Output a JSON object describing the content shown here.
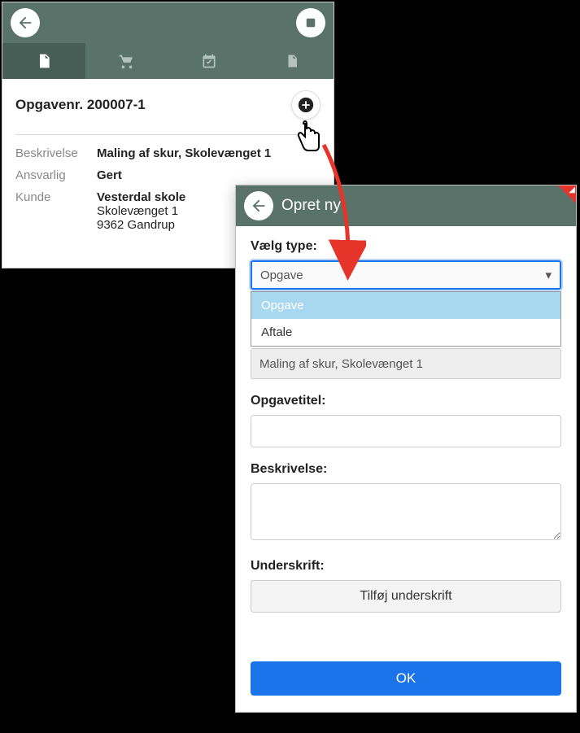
{
  "left": {
    "title": "Opgavenr. 200007-1",
    "fields": {
      "beskrivelse_label": "Beskrivelse",
      "beskrivelse_value": "Maling af skur, Skolevænget 1",
      "ansvarlig_label": "Ansvarlig",
      "ansvarlig_value": "Gert",
      "kunde_label": "Kunde",
      "kunde_value": "Vesterdal skole",
      "kunde_addr1": "Skolevænget 1",
      "kunde_addr2": "9362 Gandrup"
    }
  },
  "modal": {
    "header_title": "Opret ny",
    "type_label": "Vælg type:",
    "type_selected": "Opgave",
    "type_options": [
      "Opgave",
      "Aftale"
    ],
    "readonly_value": "Maling af skur, Skolevænget 1",
    "opgavetitel_label": "Opgavetitel:",
    "opgavetitel_value": "",
    "beskrivelse_label": "Beskrivelse:",
    "beskrivelse_value": "",
    "underskrift_label": "Underskrift:",
    "signature_btn": "Tilføj underskrift",
    "ok_btn": "OK"
  }
}
